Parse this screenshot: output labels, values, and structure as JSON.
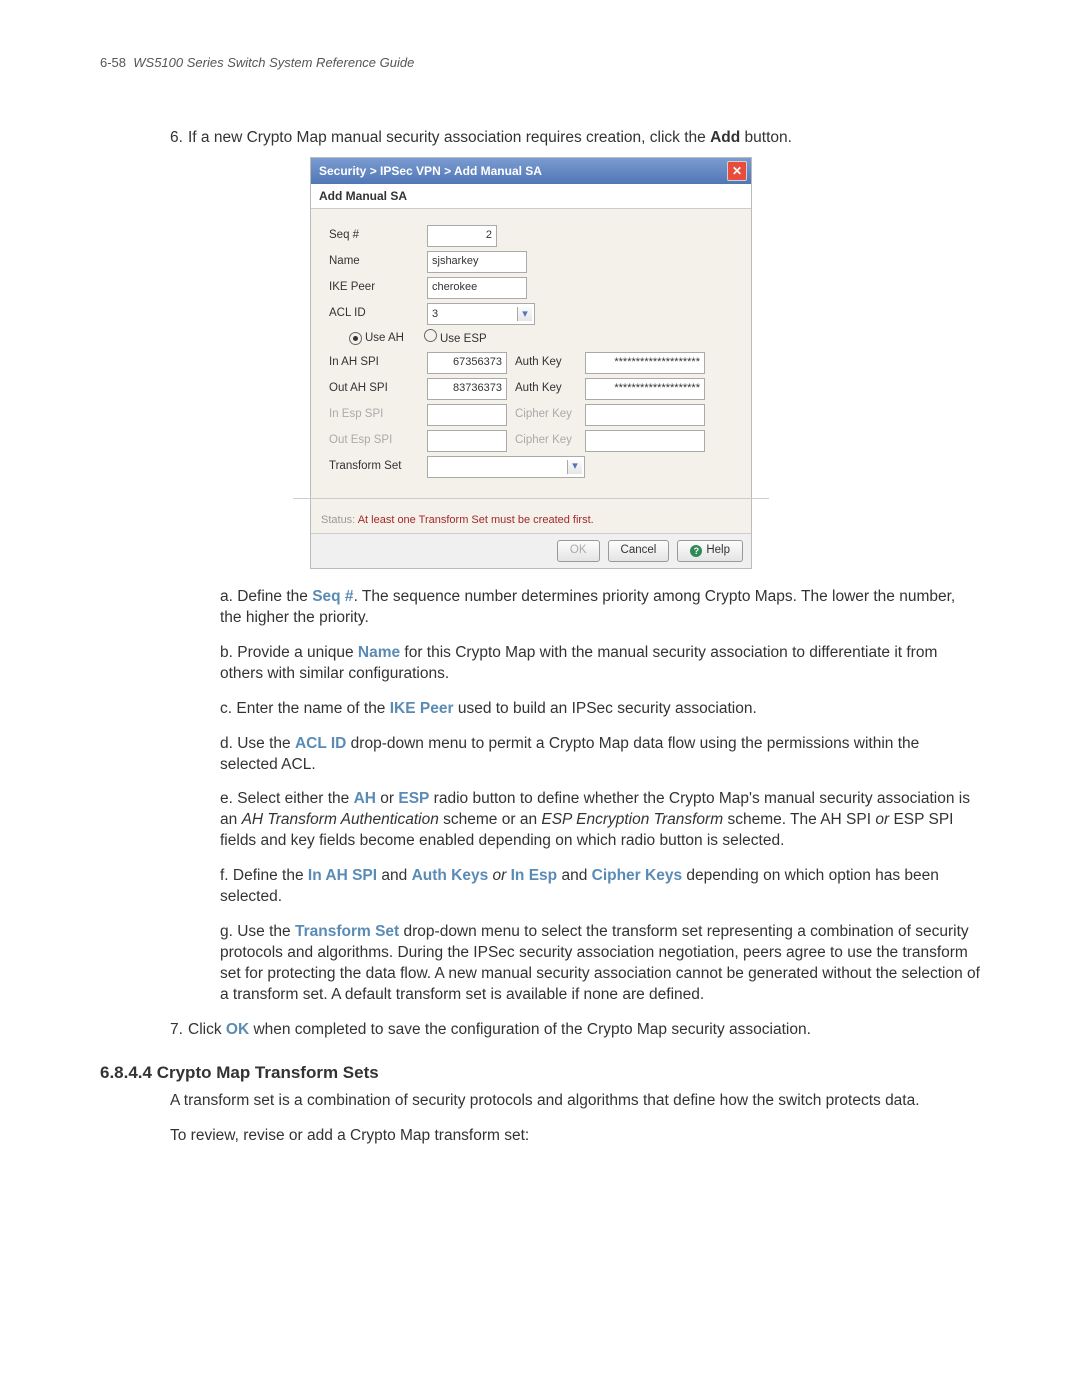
{
  "header": {
    "page_marker": "6-58",
    "doc_title": "WS5100 Series Switch System Reference Guide"
  },
  "step6": {
    "num": "6.",
    "prefix": "If a new Crypto Map manual security association requires creation, click the ",
    "bold_add": "Add",
    "suffix": " button."
  },
  "dialog": {
    "breadcrumb": "Security > IPSec VPN > Add Manual SA",
    "subtitle": "Add Manual SA",
    "labels": {
      "seq": "Seq #",
      "name": "Name",
      "ike": "IKE Peer",
      "acl": "ACL ID",
      "use_ah": "Use AH",
      "use_esp": "Use ESP",
      "in_ah": "In AH SPI",
      "out_ah": "Out AH SPI",
      "in_esp": "In Esp SPI",
      "out_esp": "Out Esp SPI",
      "auth_key": "Auth Key",
      "cipher_key": "Cipher Key",
      "transform": "Transform Set"
    },
    "values": {
      "seq": "2",
      "name": "sjsharkey",
      "ike": "cherokee",
      "acl": "3",
      "in_ah": "67356373",
      "out_ah": "83736373",
      "auth_mask": "********************",
      "transform": ""
    },
    "status_prefix": "Status:",
    "status_msg": "At least one Transform Set must be created first.",
    "buttons": {
      "ok": "OK",
      "cancel": "Cancel",
      "help": "Help"
    }
  },
  "sub": {
    "a1": "a. Define the ",
    "a_bold": "Seq #",
    "a2": ". The sequence number determines priority among Crypto Maps. The lower the number, the higher the priority.",
    "b1": "b. Provide a unique ",
    "b_bold": "Name",
    "b2": " for this Crypto Map with the manual security association to differentiate it from others with similar configurations.",
    "c1": "c. Enter the name of the ",
    "c_bold": "IKE Peer",
    "c2": " used to build an IPSec security association.",
    "d1": "d. Use the ",
    "d_bold": "ACL ID",
    "d2": " drop-down menu to permit a Crypto Map data flow using the permissions within the selected ACL.",
    "e1": "e. Select either the ",
    "e_b1": "AH",
    "e_or": " or ",
    "e_b2": "ESP",
    "e2": " radio button to define whether the Crypto Map's manual security association is an ",
    "e_i1": "AH Transform Authentication",
    "e3": " scheme or an ",
    "e_i2": "ESP Encryption Transform",
    "e4": " scheme. The AH SPI ",
    "e_i3": "or",
    "e5": " ESP SPI fields and key fields become enabled depending on which radio button is selected.",
    "f1": "f. Define the ",
    "f_b1": "In AH SPI",
    "f_and1": " and ",
    "f_b2": "Auth Keys",
    "f_or": " or ",
    "f_b3": "In Esp",
    "f_and2": " and ",
    "f_b4": "Cipher Keys",
    "f2": " depending on which option has been selected.",
    "g1": "g. Use the ",
    "g_bold": "Transform Set",
    "g2": " drop-down menu to select the transform set representing a combination of security protocols and algorithms. During the IPSec security association negotiation, peers agree to use the transform set for protecting the data flow. A new manual security association cannot be generated without the selection of a transform set. A default transform set is available if none are defined."
  },
  "step7": {
    "num": "7.",
    "t1": "Click ",
    "bold": "OK",
    "t2": " when completed to save the configuration of the Crypto Map security association."
  },
  "section": {
    "heading": "6.8.4.4 Crypto Map Transform Sets",
    "p1": "A transform set is a combination of security protocols and algorithms that define how the switch protects data.",
    "p2": "To review, revise or add a Crypto Map transform set:"
  }
}
